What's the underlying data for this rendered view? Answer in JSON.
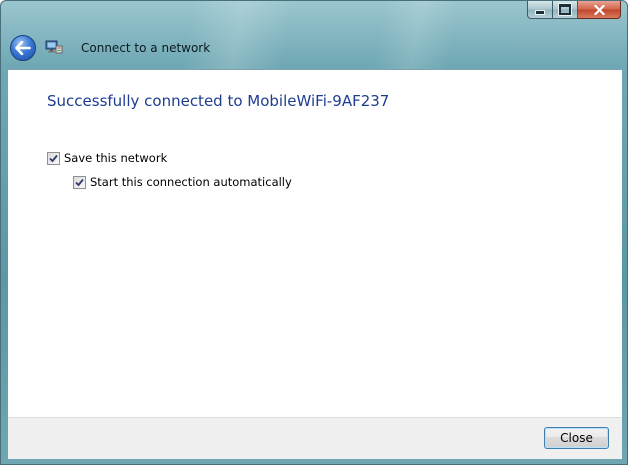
{
  "window": {
    "title": "Connect to a network"
  },
  "content": {
    "heading": "Successfully connected to MobileWiFi-9AF237",
    "options": [
      {
        "label": "Save this network",
        "checked": true
      },
      {
        "label": "Start this connection automatically",
        "checked": true
      }
    ]
  },
  "footer": {
    "close_label": "Close"
  },
  "icons": {
    "back": "back-arrow-icon",
    "network": "network-connection-icon",
    "minimize": "minimize-icon",
    "maximize": "maximize-icon",
    "close": "close-x-icon"
  }
}
